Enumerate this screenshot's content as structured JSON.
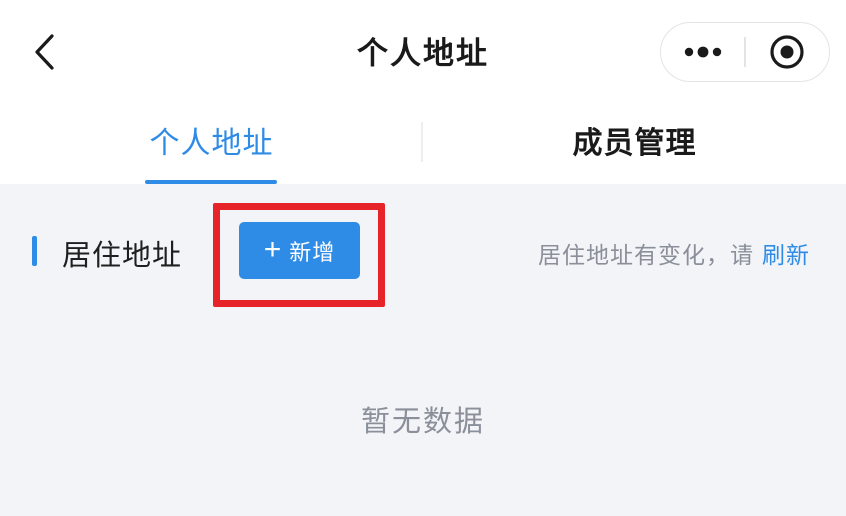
{
  "navbar": {
    "title": "个人地址",
    "back_icon": "chevron-left-icon",
    "more_icon": "more-dots-icon",
    "close_icon": "record-circle-icon"
  },
  "tabs": [
    {
      "label": "个人地址",
      "active": true
    },
    {
      "label": "成员管理",
      "active": false
    }
  ],
  "section": {
    "title": "居住地址",
    "add_button": {
      "icon": "plus-icon",
      "plus": "+",
      "label": "新增"
    },
    "hint_text": "居住地址有变化，请",
    "refresh_link": "刷新"
  },
  "empty_state": {
    "text": "暂无数据"
  },
  "colors": {
    "primary": "#2f8ce6",
    "highlight": "#e52328",
    "background": "#f2f4f8",
    "text_muted": "#8a8f99"
  }
}
